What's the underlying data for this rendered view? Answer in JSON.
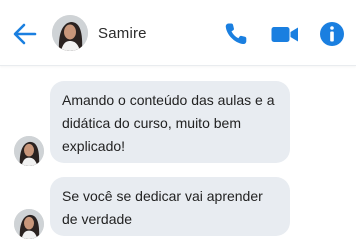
{
  "header": {
    "back_icon": "arrow-left-icon",
    "contact_name": "Samire",
    "actions": [
      "phone-icon",
      "video-camera-icon",
      "info-icon"
    ],
    "accent_color": "#1a7fe0"
  },
  "messages": [
    {
      "text": "Amando o conteúdo das aulas e a didática do curso, muito bem explicado!"
    },
    {
      "text": "Se você se dedicar vai aprender de verdade"
    }
  ],
  "colors": {
    "bubble_bg": "#e8ecf1",
    "text": "#222222"
  }
}
